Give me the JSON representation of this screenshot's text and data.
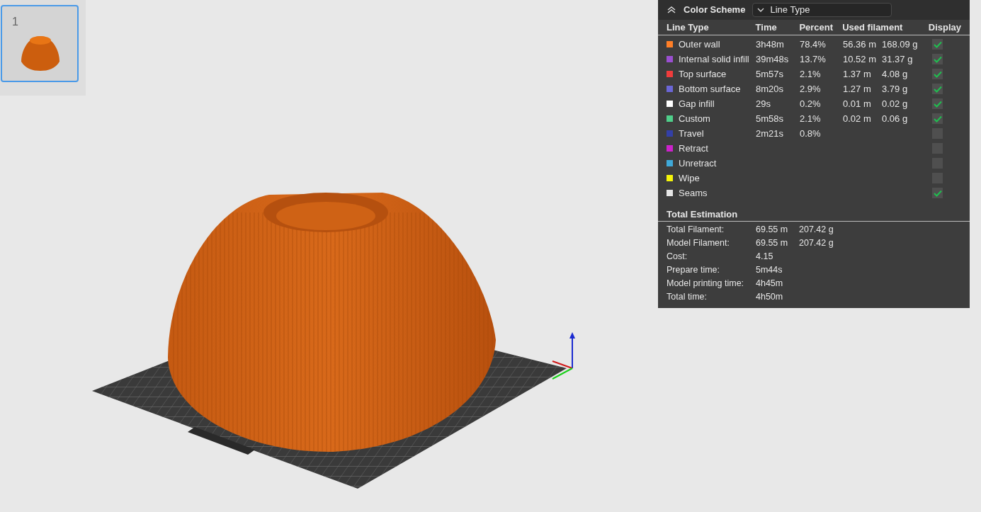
{
  "plates": [
    {
      "number": "1",
      "selected": true
    }
  ],
  "legend": {
    "title": "Color Scheme",
    "scheme": "Line Type",
    "columns": [
      "Line Type",
      "Time",
      "Percent",
      "Used filament",
      "Display"
    ],
    "rows": [
      {
        "name": "Outer wall",
        "color": "#ff7f27",
        "time": "3h48m",
        "percent": "78.4%",
        "length": "56.36 m",
        "weight": "168.09 g",
        "checked": true
      },
      {
        "name": "Internal solid infill",
        "color": "#9a4fd1",
        "time": "39m48s",
        "percent": "13.7%",
        "length": "10.52 m",
        "weight": "31.37 g",
        "checked": true
      },
      {
        "name": "Top surface",
        "color": "#f03c3c",
        "time": "5m57s",
        "percent": "2.1%",
        "length": "1.37 m",
        "weight": "4.08 g",
        "checked": true
      },
      {
        "name": "Bottom surface",
        "color": "#6b66d6",
        "time": "8m20s",
        "percent": "2.9%",
        "length": "1.27 m",
        "weight": "3.79 g",
        "checked": true
      },
      {
        "name": "Gap infill",
        "color": "#ffffff",
        "time": "29s",
        "percent": "0.2%",
        "length": "0.01 m",
        "weight": "0.02 g",
        "checked": true
      },
      {
        "name": "Custom",
        "color": "#4fcf8a",
        "time": "5m58s",
        "percent": "2.1%",
        "length": "0.02 m",
        "weight": "0.06 g",
        "checked": true
      },
      {
        "name": "Travel",
        "color": "#3340a8",
        "time": "2m21s",
        "percent": "0.8%",
        "checked": false
      },
      {
        "name": "Retract",
        "color": "#cc22cc",
        "checked": false
      },
      {
        "name": "Unretract",
        "color": "#3fa9d9",
        "checked": false
      },
      {
        "name": "Wipe",
        "color": "#f5f50a",
        "checked": false
      },
      {
        "name": "Seams",
        "color": "#e6e6e6",
        "checked": true
      }
    ],
    "estimation_title": "Total Estimation",
    "estimation": [
      {
        "label": "Total Filament:",
        "value": "69.55 m",
        "extra": "207.42 g"
      },
      {
        "label": "Model Filament:",
        "value": "69.55 m",
        "extra": "207.42 g"
      },
      {
        "label": "Cost:",
        "value": "4.15"
      },
      {
        "label": "Prepare time:",
        "value": "5m44s"
      },
      {
        "label": "Model printing time:",
        "value": "4h45m"
      },
      {
        "label": "Total time:",
        "value": "4h50m"
      }
    ]
  }
}
